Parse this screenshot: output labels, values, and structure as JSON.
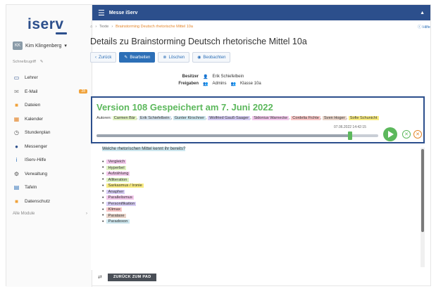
{
  "sidebar": {
    "logo": "iserv",
    "user": {
      "initials": "KK",
      "name": "Kim Klingenberg"
    },
    "quick_access": "Schnellzugriff",
    "items": [
      {
        "label": "Lehrer",
        "icon": "chalkboard-icon",
        "color": "#2c4f8c"
      },
      {
        "label": "E-Mail",
        "icon": "mail-icon",
        "color": "#888888",
        "badge": "28"
      },
      {
        "label": "Dateien",
        "icon": "folder-icon",
        "color": "#f0a23a"
      },
      {
        "label": "Kalender",
        "icon": "calendar-icon",
        "color": "#e3862b"
      },
      {
        "label": "Stundenplan",
        "icon": "clock-icon",
        "color": "#555555"
      },
      {
        "label": "Messenger",
        "icon": "messenger-icon",
        "color": "#2c4f8c"
      },
      {
        "label": "IServ-Hilfe",
        "icon": "help-icon",
        "color": "#2c6fb7"
      },
      {
        "label": "Verwaltung",
        "icon": "gear-icon",
        "color": "#555555"
      },
      {
        "label": "Tafeln",
        "icon": "board-icon",
        "color": "#2c6fb7"
      },
      {
        "label": "Datenschutz",
        "icon": "folder-icon",
        "color": "#f0a23a"
      }
    ],
    "modules_label": "Alle Module"
  },
  "topbar": {
    "title": "Messe iServ",
    "bell": "▲"
  },
  "breadcrumb": {
    "home": "⌂",
    "items": [
      "Texte",
      "Brainstorming Deutsch rhetorische Mittel 10a"
    ],
    "help": "Hilfe"
  },
  "page": {
    "title": "Details zu Brainstorming Deutsch rhetorische Mittel 10a",
    "toolbar": {
      "back": "Zurück",
      "edit": "Bearbeiten",
      "delete": "Löschen",
      "watch": "Beobachten"
    },
    "details": {
      "owner_label": "Besitzer",
      "owner_value": "Erik Schiefelbein",
      "shares_label": "Freigaben",
      "shares_value": "Admins",
      "shares_value2": "Klasse 10a"
    }
  },
  "version": {
    "title": "Version 108 Gespeichert am 7. Juni 2022",
    "authors_label": "Autoren:",
    "authors": [
      {
        "name": "Carmen Bär",
        "color": "#dff2c0"
      },
      {
        "name": "Erik Schiefelbein",
        "color": "#d7e4ef"
      },
      {
        "name": "Gunter Kirschner",
        "color": "#cde7ef"
      },
      {
        "name": "Wolfried Gauß-Saager",
        "color": "#d7cdf5"
      },
      {
        "name": "Sidonius Warnecke",
        "color": "#f3c8ec"
      },
      {
        "name": "Cordelia Fichte",
        "color": "#f9c7c7"
      },
      {
        "name": "Sven Hoger",
        "color": "#e9d4c9"
      },
      {
        "name": "Sofie Schunicht",
        "color": "#f9ec82"
      }
    ],
    "timestamp": "07.06.2022 14:42:15",
    "progress": 0.9
  },
  "editor": {
    "question": "Welche rhetorischen Mittel kennt ihr bereits?",
    "question_color": "#cde7ef",
    "items": [
      {
        "text": "Vergleich",
        "color": "#f3c8ec"
      },
      {
        "text": "Hyperbel",
        "color": "#dff2c0"
      },
      {
        "text": "Aufzählung",
        "color": "#f3c8ec"
      },
      {
        "text": "Alliteration",
        "color": "#dff2c0"
      },
      {
        "text": "Sarkasmus / Ironie",
        "color": "#f9ec82"
      },
      {
        "text": "Anapher",
        "color": "#d7cdf5"
      },
      {
        "text": "Parallelismus",
        "color": "#f3c8ec"
      },
      {
        "text": "Personifikation",
        "color": "#d7cdf5"
      },
      {
        "text": "Klimax",
        "color": "#f9c7c7"
      },
      {
        "text": "Parataxe",
        "color": "#e9d4c9"
      },
      {
        "text": "Paradoxon",
        "color": "#cde7ef"
      }
    ]
  },
  "bottom": {
    "back_to_pad": "ZURÜCK ZUM PAD"
  }
}
